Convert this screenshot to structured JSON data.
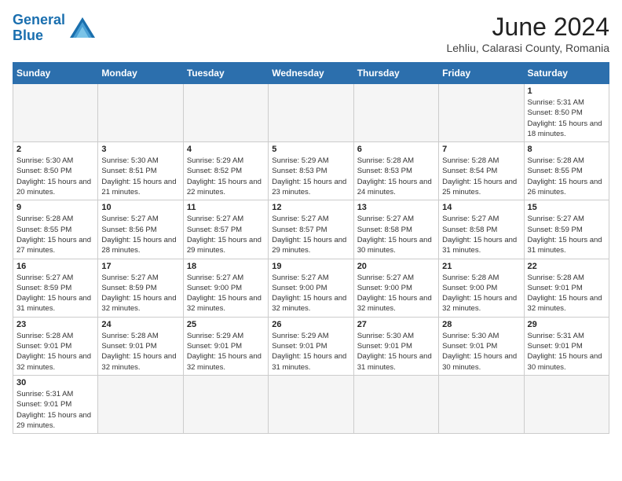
{
  "header": {
    "logo_general": "General",
    "logo_blue": "Blue",
    "title": "June 2024",
    "subtitle": "Lehliu, Calarasi County, Romania"
  },
  "weekdays": [
    "Sunday",
    "Monday",
    "Tuesday",
    "Wednesday",
    "Thursday",
    "Friday",
    "Saturday"
  ],
  "days": [
    {
      "date": "",
      "empty": true
    },
    {
      "date": "",
      "empty": true
    },
    {
      "date": "",
      "empty": true
    },
    {
      "date": "",
      "empty": true
    },
    {
      "date": "",
      "empty": true
    },
    {
      "date": "",
      "empty": true
    },
    {
      "date": "1",
      "info": "Sunrise: 5:31 AM\nSunset: 8:50 PM\nDaylight: 15 hours and 18 minutes."
    },
    {
      "date": "2",
      "info": "Sunrise: 5:30 AM\nSunset: 8:50 PM\nDaylight: 15 hours and 20 minutes."
    },
    {
      "date": "3",
      "info": "Sunrise: 5:30 AM\nSunset: 8:51 PM\nDaylight: 15 hours and 21 minutes."
    },
    {
      "date": "4",
      "info": "Sunrise: 5:29 AM\nSunset: 8:52 PM\nDaylight: 15 hours and 22 minutes."
    },
    {
      "date": "5",
      "info": "Sunrise: 5:29 AM\nSunset: 8:53 PM\nDaylight: 15 hours and 23 minutes."
    },
    {
      "date": "6",
      "info": "Sunrise: 5:28 AM\nSunset: 8:53 PM\nDaylight: 15 hours and 24 minutes."
    },
    {
      "date": "7",
      "info": "Sunrise: 5:28 AM\nSunset: 8:54 PM\nDaylight: 15 hours and 25 minutes."
    },
    {
      "date": "8",
      "info": "Sunrise: 5:28 AM\nSunset: 8:55 PM\nDaylight: 15 hours and 26 minutes."
    },
    {
      "date": "9",
      "info": "Sunrise: 5:28 AM\nSunset: 8:55 PM\nDaylight: 15 hours and 27 minutes."
    },
    {
      "date": "10",
      "info": "Sunrise: 5:27 AM\nSunset: 8:56 PM\nDaylight: 15 hours and 28 minutes."
    },
    {
      "date": "11",
      "info": "Sunrise: 5:27 AM\nSunset: 8:57 PM\nDaylight: 15 hours and 29 minutes."
    },
    {
      "date": "12",
      "info": "Sunrise: 5:27 AM\nSunset: 8:57 PM\nDaylight: 15 hours and 29 minutes."
    },
    {
      "date": "13",
      "info": "Sunrise: 5:27 AM\nSunset: 8:58 PM\nDaylight: 15 hours and 30 minutes."
    },
    {
      "date": "14",
      "info": "Sunrise: 5:27 AM\nSunset: 8:58 PM\nDaylight: 15 hours and 31 minutes."
    },
    {
      "date": "15",
      "info": "Sunrise: 5:27 AM\nSunset: 8:59 PM\nDaylight: 15 hours and 31 minutes."
    },
    {
      "date": "16",
      "info": "Sunrise: 5:27 AM\nSunset: 8:59 PM\nDaylight: 15 hours and 31 minutes."
    },
    {
      "date": "17",
      "info": "Sunrise: 5:27 AM\nSunset: 8:59 PM\nDaylight: 15 hours and 32 minutes."
    },
    {
      "date": "18",
      "info": "Sunrise: 5:27 AM\nSunset: 9:00 PM\nDaylight: 15 hours and 32 minutes."
    },
    {
      "date": "19",
      "info": "Sunrise: 5:27 AM\nSunset: 9:00 PM\nDaylight: 15 hours and 32 minutes."
    },
    {
      "date": "20",
      "info": "Sunrise: 5:27 AM\nSunset: 9:00 PM\nDaylight: 15 hours and 32 minutes."
    },
    {
      "date": "21",
      "info": "Sunrise: 5:28 AM\nSunset: 9:00 PM\nDaylight: 15 hours and 32 minutes."
    },
    {
      "date": "22",
      "info": "Sunrise: 5:28 AM\nSunset: 9:01 PM\nDaylight: 15 hours and 32 minutes."
    },
    {
      "date": "23",
      "info": "Sunrise: 5:28 AM\nSunset: 9:01 PM\nDaylight: 15 hours and 32 minutes."
    },
    {
      "date": "24",
      "info": "Sunrise: 5:28 AM\nSunset: 9:01 PM\nDaylight: 15 hours and 32 minutes."
    },
    {
      "date": "25",
      "info": "Sunrise: 5:29 AM\nSunset: 9:01 PM\nDaylight: 15 hours and 32 minutes."
    },
    {
      "date": "26",
      "info": "Sunrise: 5:29 AM\nSunset: 9:01 PM\nDaylight: 15 hours and 31 minutes."
    },
    {
      "date": "27",
      "info": "Sunrise: 5:30 AM\nSunset: 9:01 PM\nDaylight: 15 hours and 31 minutes."
    },
    {
      "date": "28",
      "info": "Sunrise: 5:30 AM\nSunset: 9:01 PM\nDaylight: 15 hours and 30 minutes."
    },
    {
      "date": "29",
      "info": "Sunrise: 5:31 AM\nSunset: 9:01 PM\nDaylight: 15 hours and 30 minutes."
    },
    {
      "date": "30",
      "info": "Sunrise: 5:31 AM\nSunset: 9:01 PM\nDaylight: 15 hours and 29 minutes."
    },
    {
      "date": "",
      "empty": true
    },
    {
      "date": "",
      "empty": true
    },
    {
      "date": "",
      "empty": true
    },
    {
      "date": "",
      "empty": true
    },
    {
      "date": "",
      "empty": true
    },
    {
      "date": "",
      "empty": true
    }
  ]
}
